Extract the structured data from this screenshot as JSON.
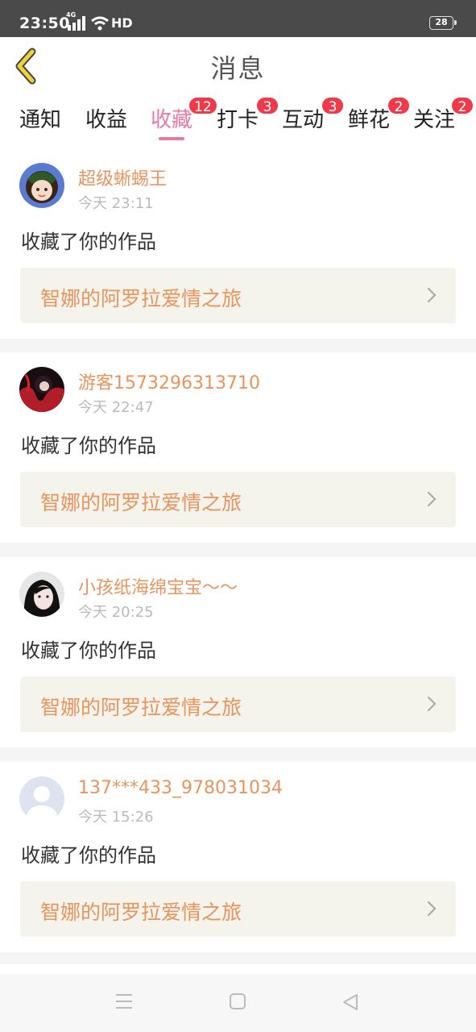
{
  "status_bar": {
    "time": "23:50",
    "network": "4G",
    "hd": "HD",
    "battery": "28"
  },
  "header": {
    "title": "消息"
  },
  "tabs": [
    {
      "label": "通知",
      "badge": ""
    },
    {
      "label": "收益",
      "badge": ""
    },
    {
      "label": "收藏",
      "badge": "12"
    },
    {
      "label": "打卡",
      "badge": "3"
    },
    {
      "label": "互动",
      "badge": "3"
    },
    {
      "label": "鲜花",
      "badge": "2"
    },
    {
      "label": "关注",
      "badge": "2"
    }
  ],
  "active_tab": "收藏",
  "messages": [
    {
      "user": "超级蜥蜴王",
      "time": "今天 23:11",
      "action": "收藏了你的作品",
      "work": "智娜的阿罗拉爱情之旅"
    },
    {
      "user": "游客1573296313710",
      "time": "今天 22:47",
      "action": "收藏了你的作品",
      "work": "智娜的阿罗拉爱情之旅"
    },
    {
      "user": "小孩纸海绵宝宝〜〜",
      "time": "今天 20:25",
      "action": "收藏了你的作品",
      "work": "智娜的阿罗拉爱情之旅"
    },
    {
      "user": "137***433_978031034",
      "time": "今天 15:26",
      "action": "收藏了你的作品",
      "work": "智娜的阿罗拉爱情之旅"
    }
  ],
  "colors": {
    "accent": "#e87aa8",
    "name": "#e8945e",
    "badge": "#ee3a4a",
    "link_bg": "#f4f4ec",
    "back_arrow": "#f2d23c"
  }
}
